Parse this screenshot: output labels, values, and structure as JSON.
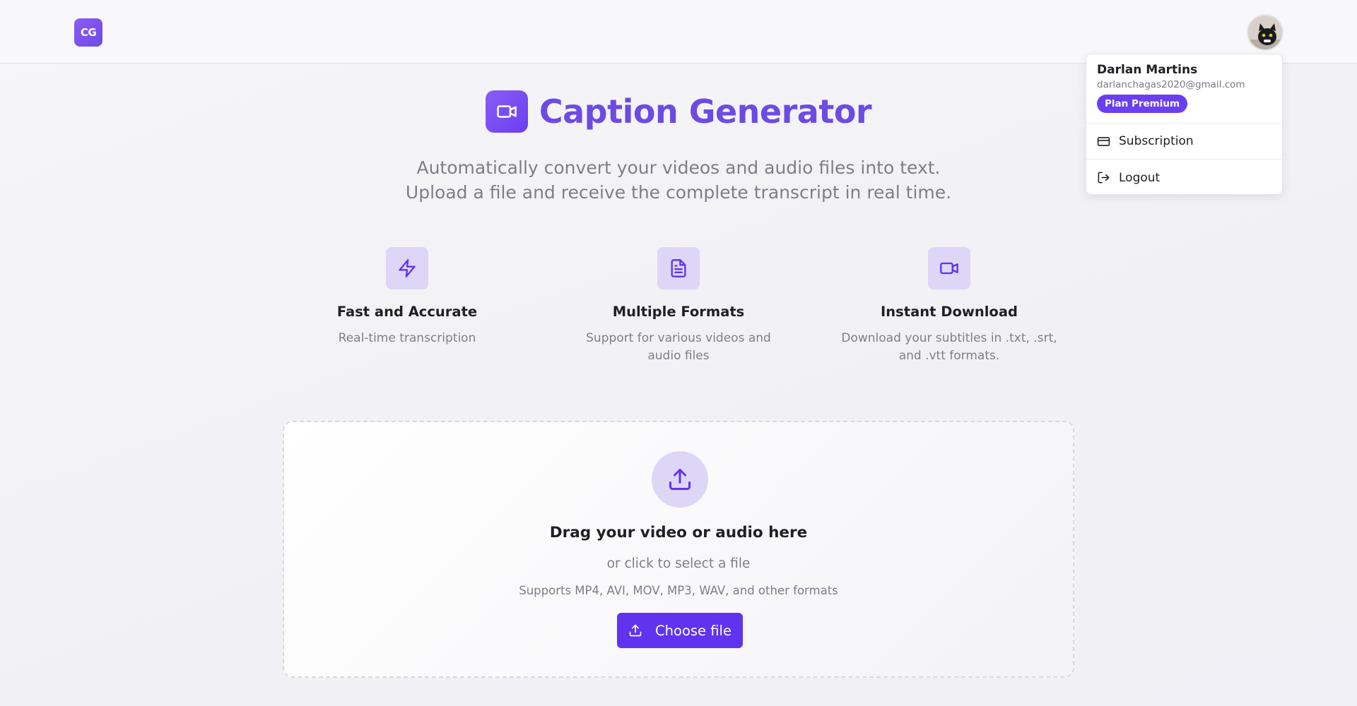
{
  "header": {
    "logo_text": "CG",
    "avatar_icon": "cat-avatar"
  },
  "user_menu": {
    "name": "Darlan Martins",
    "email": "darlanchagas2020@gmail.com",
    "plan_badge": "Plan Premium",
    "items": [
      {
        "label": "Subscription",
        "icon": "credit-card-icon"
      },
      {
        "label": "Logout",
        "icon": "logout-icon"
      }
    ]
  },
  "hero": {
    "title": "Caption Generator",
    "subtitle": "Automatically convert your videos and audio files into text. Upload a file and receive the complete transcript in real time."
  },
  "features": [
    {
      "title": "Fast and Accurate",
      "description": "Real-time transcription",
      "icon": "zap-icon"
    },
    {
      "title": "Multiple Formats",
      "description": "Support for various videos and audio files",
      "icon": "file-text-icon"
    },
    {
      "title": "Instant Download",
      "description": "Download your subtitles in .txt, .srt, and .vtt formats.",
      "icon": "video-icon"
    }
  ],
  "upload": {
    "title": "Drag your video or audio here",
    "subtitle": "or click to select a file",
    "formats": "Supports MP4, AVI, MOV, MP3, WAV, and other formats",
    "button_label": "Choose file"
  },
  "colors": {
    "accent": "#6033ee",
    "accent_light": "#ddd6f7",
    "title_purple": "#6d4be3"
  }
}
